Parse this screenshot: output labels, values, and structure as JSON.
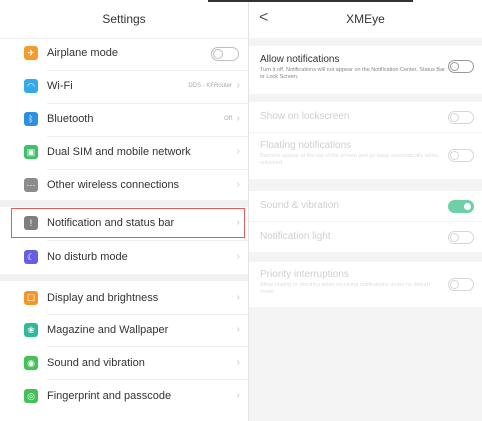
{
  "settings": {
    "title": "Settings",
    "items": [
      {
        "label": "Airplane mode",
        "value": "",
        "icon": "airplane-icon",
        "color": "#f39b2b"
      },
      {
        "label": "Wi-Fi",
        "value": "DDS - KFRouter",
        "icon": "wifi-icon",
        "color": "#34a9e8"
      },
      {
        "label": "Bluetooth",
        "value": "Off",
        "icon": "bluetooth-icon",
        "color": "#2c8fe0"
      },
      {
        "label": "Dual SIM and mobile network",
        "value": "",
        "icon": "sim-icon",
        "color": "#3fbf6a"
      },
      {
        "label": "Other wireless connections",
        "value": "",
        "icon": "wireless-icon",
        "color": "#8c8c8c"
      },
      {
        "label": "Notification and status bar",
        "value": "",
        "icon": "notification-icon",
        "color": "#7f7f7f"
      },
      {
        "label": "No disturb mode",
        "value": "",
        "icon": "moon-icon",
        "color": "#6a5ee0"
      },
      {
        "label": "Display and brightness",
        "value": "",
        "icon": "display-icon",
        "color": "#f2972a"
      },
      {
        "label": "Magazine and Wallpaper",
        "value": "",
        "icon": "wallpaper-icon",
        "color": "#2fb89a"
      },
      {
        "label": "Sound and vibration",
        "value": "",
        "icon": "sound-icon",
        "color": "#45c257"
      },
      {
        "label": "Fingerprint and passcode",
        "value": "",
        "icon": "fingerprint-icon",
        "color": "#43c05a"
      }
    ]
  },
  "app": {
    "title": "XMEye",
    "allow": {
      "title": "Allow notifications",
      "desc": "Turn it off. Notifications will not appear on the Notification Center, Status Bar or Lock Screen."
    },
    "lockscreen": {
      "title": "Show on lockscreen"
    },
    "floating": {
      "title": "Floating notifications",
      "desc": "Banners appear at the top of the screen and go away automatically when unlocked"
    },
    "sound": {
      "title": "Sound & vibration"
    },
    "light": {
      "title": "Notification light"
    },
    "priority": {
      "title": "Priority interruptions",
      "desc": "Allow ringing or vibrating when receiving notifications under no disturb mode"
    }
  }
}
